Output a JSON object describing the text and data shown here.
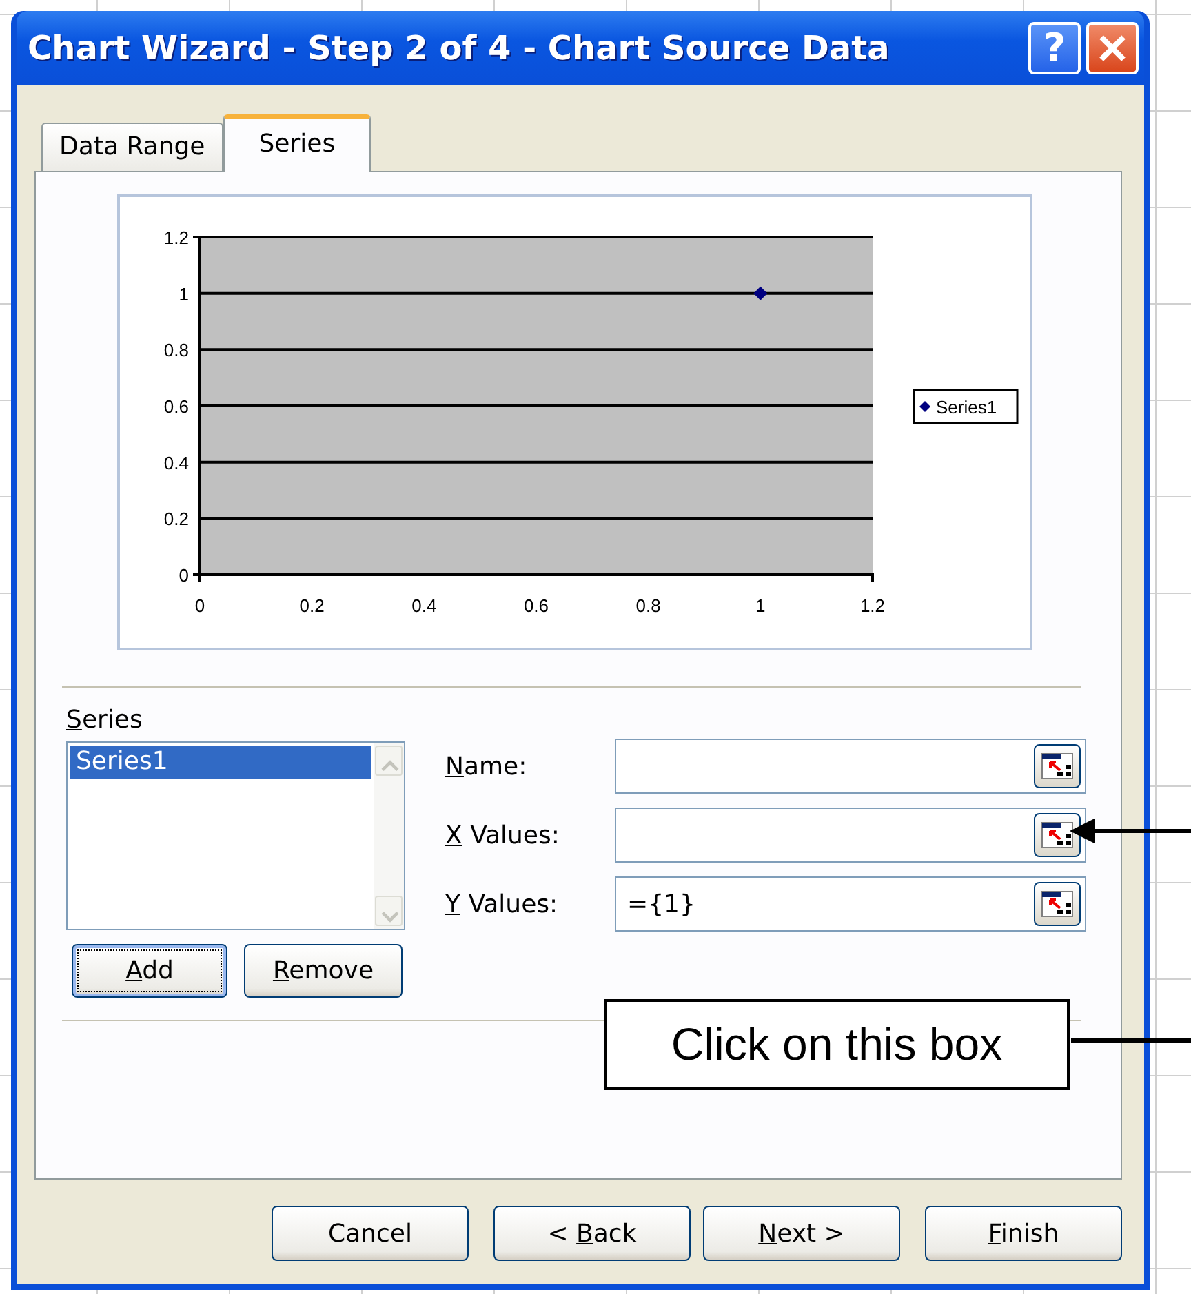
{
  "window": {
    "title": "Chart Wizard - Step 2 of 4 - Chart Source Data",
    "help_button": "?"
  },
  "tabs": [
    {
      "label": "Data Range",
      "selected": false
    },
    {
      "label": "Series",
      "selected": true
    }
  ],
  "chart": {
    "chart_data": {
      "type": "scatter",
      "x": [
        1
      ],
      "series": [
        {
          "name": "Series1",
          "color": "#000080",
          "values": [
            1
          ]
        }
      ],
      "grid": "y",
      "xlim": [
        0,
        1.2
      ],
      "ylim": [
        0,
        1.2
      ],
      "xticks": [
        0,
        0.2,
        0.4,
        0.6,
        0.8,
        1,
        1.2
      ],
      "yticks": [
        0,
        0.2,
        0.4,
        0.6,
        0.8,
        1,
        1.2
      ]
    }
  },
  "series_list": {
    "label": {
      "key": "S",
      "rest": "eries"
    },
    "items": [
      {
        "name": "Series1",
        "selected": true
      }
    ]
  },
  "list_buttons": [
    {
      "key": "A",
      "rest": "dd",
      "focused": true
    },
    {
      "key": "R",
      "rest": "emove",
      "focused": false
    }
  ],
  "fields": [
    {
      "label": {
        "key": "N",
        "rest": "ame:"
      }
    },
    {
      "label": {
        "key": "X",
        "rest": " Values:"
      }
    },
    {
      "label": {
        "key": "Y",
        "rest": " Values:"
      },
      "value": "={1}"
    }
  ],
  "buttons": [
    {
      "rest": "Cancel"
    },
    {
      "prefix": "< ",
      "key": "B",
      "rest": "ack"
    },
    {
      "key": "N",
      "rest": "ext >"
    },
    {
      "key": "F",
      "rest": "inish"
    }
  ],
  "annotation": {
    "text": "Click on this box"
  }
}
